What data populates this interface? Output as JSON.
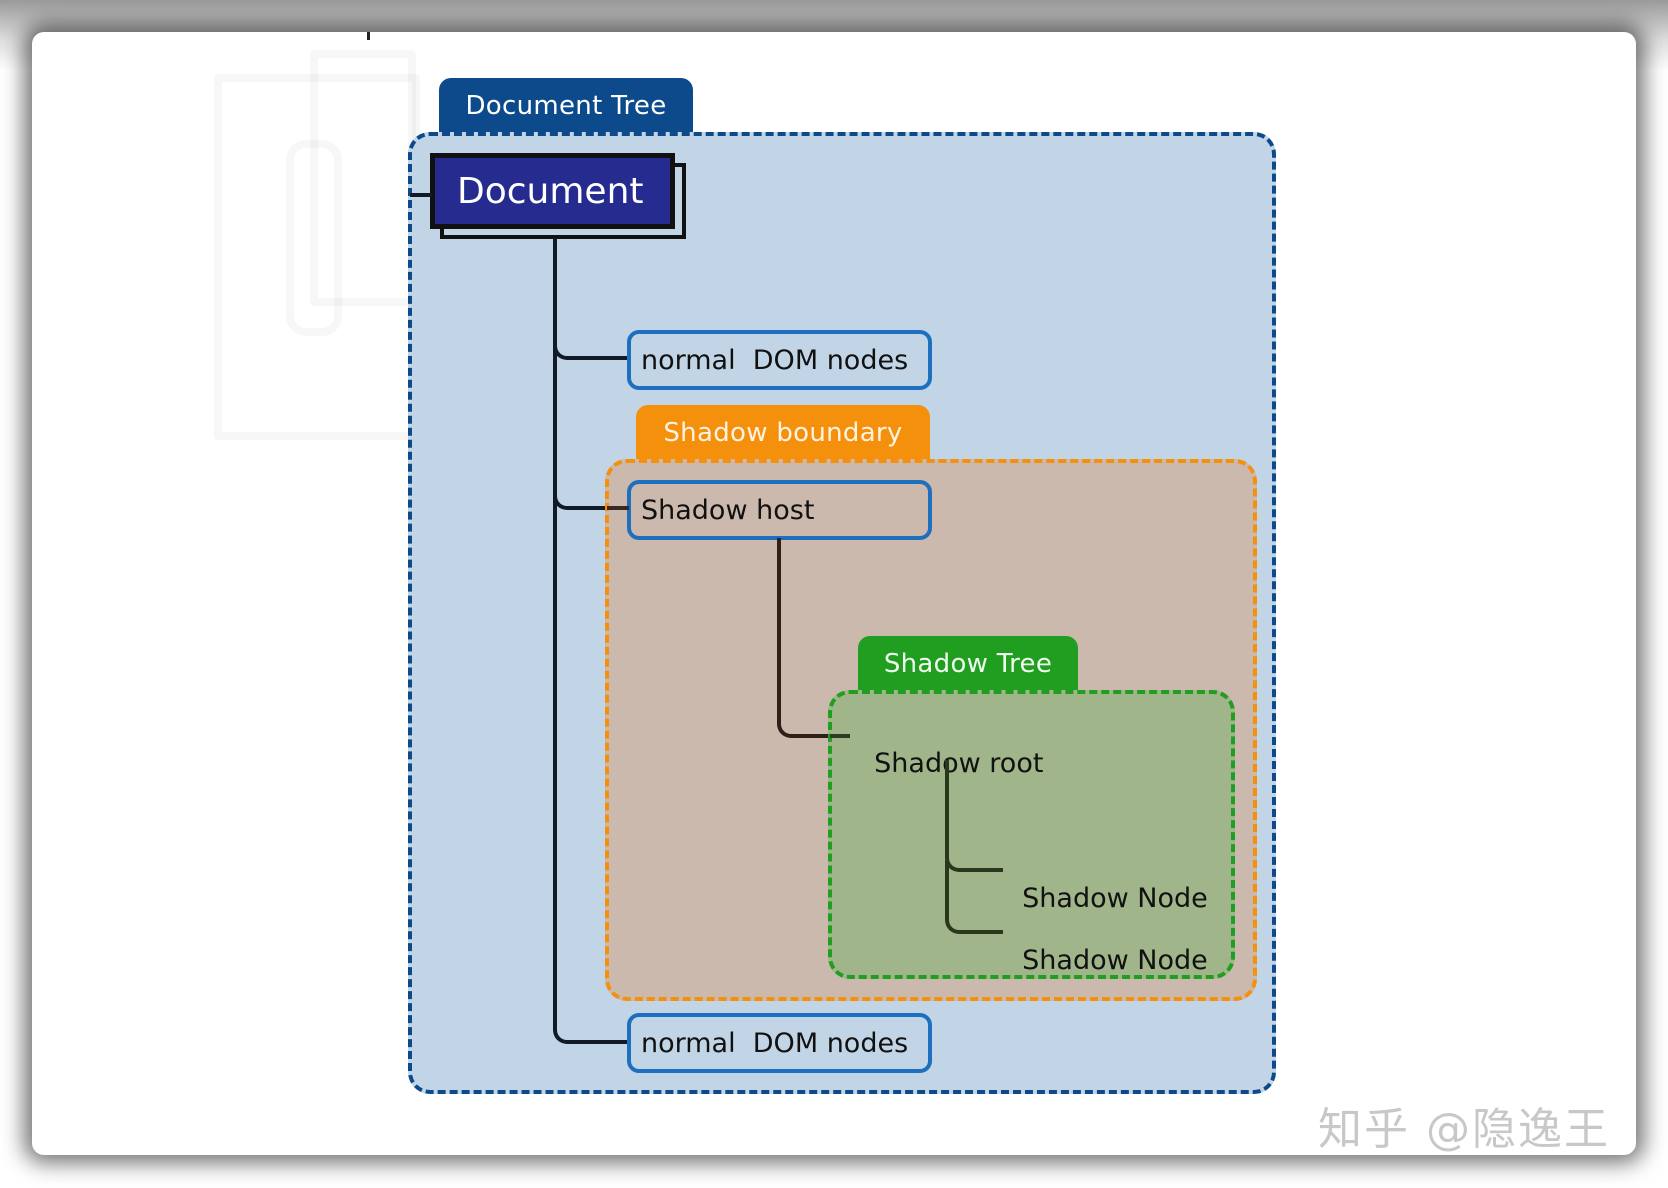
{
  "diagram": {
    "title": "Document Tree",
    "root": "Document",
    "nodes": {
      "normal_dom_top": "normal  DOM nodes",
      "shadow_host": "Shadow host",
      "shadow_root": "Shadow root",
      "shadow_node_1": "Shadow Node",
      "shadow_node_2": "Shadow Node",
      "normal_dom_bottom": "normal  DOM nodes"
    },
    "groups": {
      "document_tree": {
        "label": "Document Tree",
        "color": "#0d4a8c",
        "fill": "#c2d5e7"
      },
      "shadow_boundary": {
        "label": "Shadow boundary",
        "color": "#f5900d",
        "fill": "#cbb9ad"
      },
      "shadow_tree": {
        "label": "Shadow Tree",
        "color": "#1f9e1f",
        "fill": "#a0b58a"
      }
    },
    "colors": {
      "document_node": "#252b8f",
      "node_border": "#1f6fbf",
      "connector": "#111a26"
    }
  },
  "watermark": "知乎 @隐逸王"
}
